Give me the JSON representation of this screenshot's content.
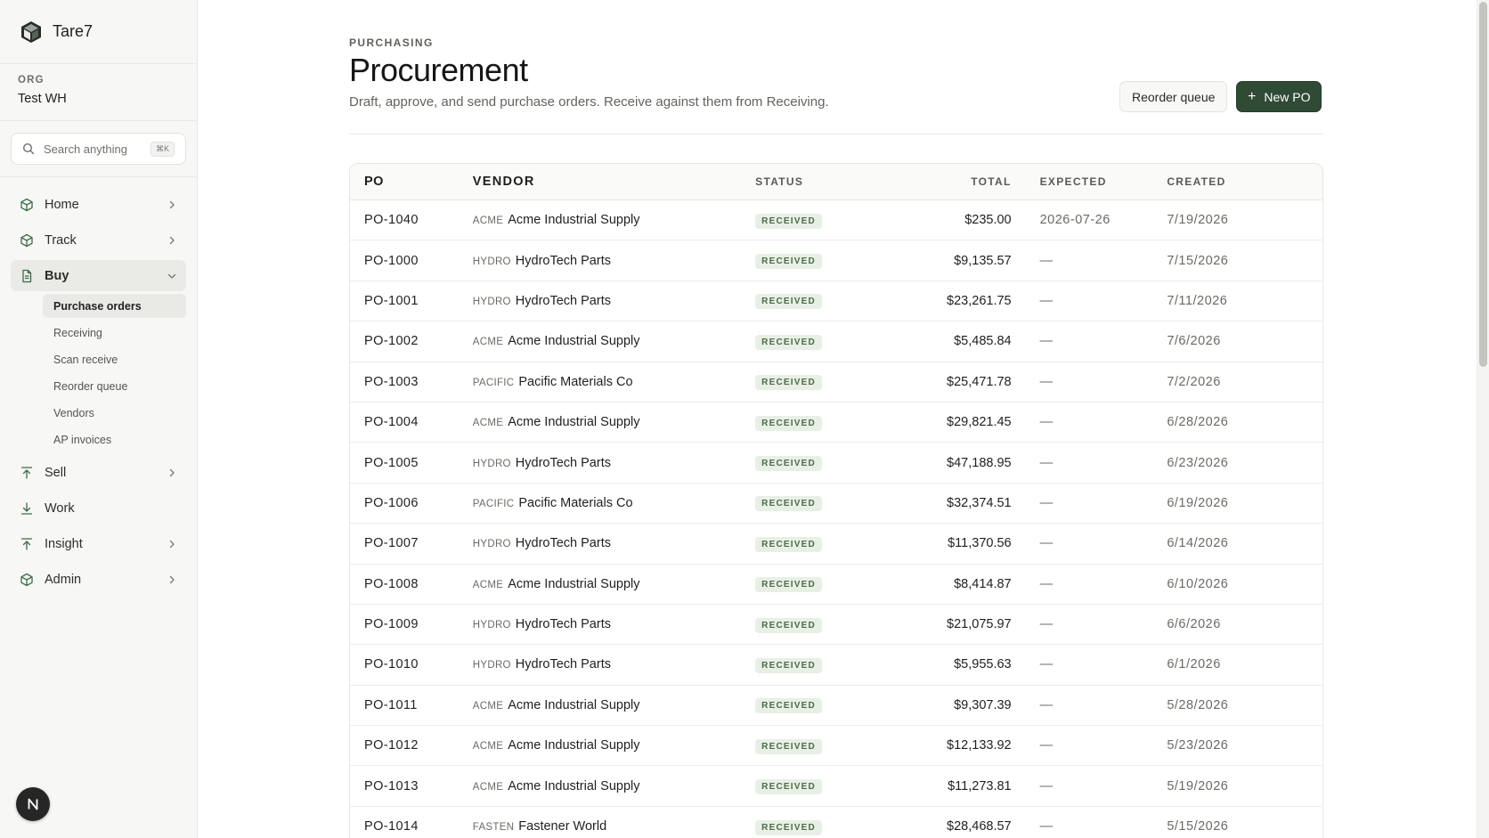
{
  "app": {
    "name": "Tare7"
  },
  "org": {
    "label": "ORG",
    "name": "Test WH"
  },
  "search": {
    "placeholder": "Search anything",
    "shortcut": "⌘K"
  },
  "nav": {
    "home": "Home",
    "track": "Track",
    "buy": "Buy",
    "buy_sub": [
      "Purchase orders",
      "Receiving",
      "Scan receive",
      "Reorder queue",
      "Vendors",
      "AP invoices"
    ],
    "sell": "Sell",
    "work": "Work",
    "insight": "Insight",
    "admin": "Admin"
  },
  "user": {
    "initial": "N"
  },
  "header": {
    "eyebrow": "PURCHASING",
    "title": "Procurement",
    "description": "Draft, approve, and send purchase orders. Receive against them from Receiving.",
    "reorder_label": "Reorder queue",
    "new_po_label": "New PO",
    "new_po_icon": "+"
  },
  "table": {
    "columns": {
      "po": "PO",
      "vendor": "VENDOR",
      "status": "STATUS",
      "total": "TOTAL",
      "expected": "EXPECTED",
      "created": "CREATED"
    },
    "rows": [
      {
        "po": "PO-1040",
        "vcode": "ACME",
        "vendor": "Acme Industrial Supply",
        "status": "RECEIVED",
        "total": "$235.00",
        "expected": "2026-07-26",
        "created": "7/19/2026"
      },
      {
        "po": "PO-1000",
        "vcode": "HYDRO",
        "vendor": "HydroTech Parts",
        "status": "RECEIVED",
        "total": "$9,135.57",
        "expected": "—",
        "created": "7/15/2026"
      },
      {
        "po": "PO-1001",
        "vcode": "HYDRO",
        "vendor": "HydroTech Parts",
        "status": "RECEIVED",
        "total": "$23,261.75",
        "expected": "—",
        "created": "7/11/2026"
      },
      {
        "po": "PO-1002",
        "vcode": "ACME",
        "vendor": "Acme Industrial Supply",
        "status": "RECEIVED",
        "total": "$5,485.84",
        "expected": "—",
        "created": "7/6/2026"
      },
      {
        "po": "PO-1003",
        "vcode": "PACIFIC",
        "vendor": "Pacific Materials Co",
        "status": "RECEIVED",
        "total": "$25,471.78",
        "expected": "—",
        "created": "7/2/2026"
      },
      {
        "po": "PO-1004",
        "vcode": "ACME",
        "vendor": "Acme Industrial Supply",
        "status": "RECEIVED",
        "total": "$29,821.45",
        "expected": "—",
        "created": "6/28/2026"
      },
      {
        "po": "PO-1005",
        "vcode": "HYDRO",
        "vendor": "HydroTech Parts",
        "status": "RECEIVED",
        "total": "$47,188.95",
        "expected": "—",
        "created": "6/23/2026"
      },
      {
        "po": "PO-1006",
        "vcode": "PACIFIC",
        "vendor": "Pacific Materials Co",
        "status": "RECEIVED",
        "total": "$32,374.51",
        "expected": "—",
        "created": "6/19/2026"
      },
      {
        "po": "PO-1007",
        "vcode": "HYDRO",
        "vendor": "HydroTech Parts",
        "status": "RECEIVED",
        "total": "$11,370.56",
        "expected": "—",
        "created": "6/14/2026"
      },
      {
        "po": "PO-1008",
        "vcode": "ACME",
        "vendor": "Acme Industrial Supply",
        "status": "RECEIVED",
        "total": "$8,414.87",
        "expected": "—",
        "created": "6/10/2026"
      },
      {
        "po": "PO-1009",
        "vcode": "HYDRO",
        "vendor": "HydroTech Parts",
        "status": "RECEIVED",
        "total": "$21,075.97",
        "expected": "—",
        "created": "6/6/2026"
      },
      {
        "po": "PO-1010",
        "vcode": "HYDRO",
        "vendor": "HydroTech Parts",
        "status": "RECEIVED",
        "total": "$5,955.63",
        "expected": "—",
        "created": "6/1/2026"
      },
      {
        "po": "PO-1011",
        "vcode": "ACME",
        "vendor": "Acme Industrial Supply",
        "status": "RECEIVED",
        "total": "$9,307.39",
        "expected": "—",
        "created": "5/28/2026"
      },
      {
        "po": "PO-1012",
        "vcode": "ACME",
        "vendor": "Acme Industrial Supply",
        "status": "RECEIVED",
        "total": "$12,133.92",
        "expected": "—",
        "created": "5/23/2026"
      },
      {
        "po": "PO-1013",
        "vcode": "ACME",
        "vendor": "Acme Industrial Supply",
        "status": "RECEIVED",
        "total": "$11,273.81",
        "expected": "—",
        "created": "5/19/2026"
      },
      {
        "po": "PO-1014",
        "vcode": "FASTEN",
        "vendor": "Fastener World",
        "status": "RECEIVED",
        "total": "$28,468.57",
        "expected": "—",
        "created": "5/15/2026"
      }
    ]
  },
  "colors": {
    "accent": "#2f4a35",
    "badge_bg": "#e8f0e6",
    "badge_fg": "#4c6b49",
    "sidebar_bg": "#f7f7f6"
  },
  "icons": {
    "brand": "cube-logo-icon",
    "search": "search-icon",
    "home": "cube-icon",
    "track": "cube-icon",
    "buy": "document-icon",
    "sell": "upload-arrow-icon",
    "work": "download-arrow-icon",
    "insight": "upload-arrow-icon",
    "admin": "cube-icon",
    "chevron": "chevron-right-icon"
  }
}
